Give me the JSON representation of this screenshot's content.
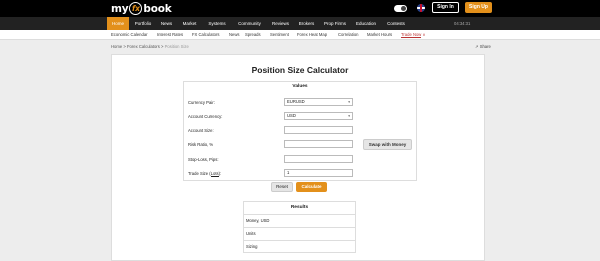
{
  "header": {
    "logo_prefix": "my",
    "logo_fx": "fx",
    "logo_suffix": "book",
    "signin_label": "Sign In",
    "signup_label": "Sign Up",
    "accent_color": "#e3901b"
  },
  "main_nav": {
    "items": [
      "Home",
      "Portfolio",
      "News",
      "Market",
      "Systems",
      "Community",
      "Reviews",
      "Brokers",
      "Prop Firms",
      "Education",
      "Contests"
    ],
    "active": "Home",
    "clock": "04:34:31"
  },
  "sub_nav": {
    "items": [
      "Economic Calendar",
      "Interest Rates",
      "FX Calculators",
      "News",
      "Spreads",
      "Sentiment",
      "Forex Heat Map",
      "Correlation",
      "Market Hours"
    ],
    "trade_now": "Trade Now"
  },
  "breadcrumb": {
    "home": "Home",
    "sep": ">",
    "section": "Forex Calculators",
    "current": "Position Size"
  },
  "share_label": "Share",
  "calculator": {
    "title": "Position Size Calculator",
    "values_title": "Values",
    "currency_pair_label": "Currency Pair:",
    "currency_pair_value": "EURUSD",
    "account_currency_label": "Account Currency:",
    "account_currency_value": "USD",
    "account_size_label": "Account Size:",
    "account_size_value": "",
    "risk_ratio_label": "Risk Ratio, %",
    "risk_ratio_value": "",
    "stop_loss_label": "Stop-Loss, Pips:",
    "stop_loss_value": "",
    "trade_size_label_prefix": "Trade Size (",
    "trade_size_label_link": "Lots",
    "trade_size_label_suffix": "):",
    "trade_size_value": "1",
    "swap_label": "Swap with Money",
    "reset_label": "Reset",
    "calculate_label": "Calculate"
  },
  "results": {
    "title": "Results",
    "rows": [
      "Money, USD",
      "Units",
      "Sizing"
    ]
  }
}
